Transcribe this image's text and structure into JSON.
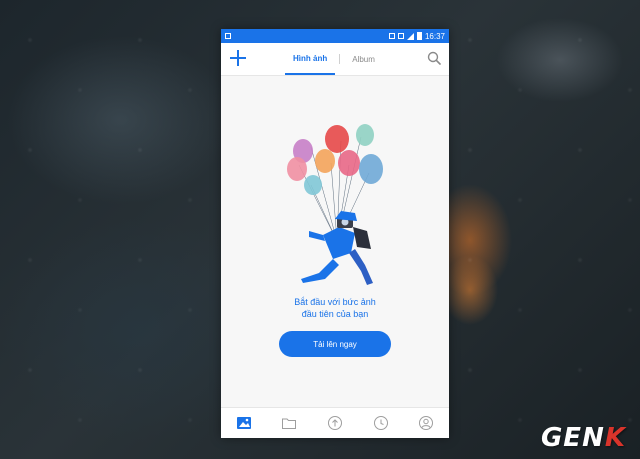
{
  "status_bar": {
    "time": "16:37"
  },
  "header": {
    "tabs": [
      {
        "label": "Hình ảnh",
        "active": true
      },
      {
        "label": "Album",
        "active": false
      }
    ]
  },
  "empty_state": {
    "line1": "Bắt đầu với bức ảnh",
    "line2": "đầu tiên của bạn",
    "cta_label": "Tải lên ngay"
  },
  "bottom_nav": {
    "items": [
      {
        "icon": "photos-icon",
        "active": true
      },
      {
        "icon": "folder-icon",
        "active": false
      },
      {
        "icon": "upload-icon",
        "active": false
      },
      {
        "icon": "clock-icon",
        "active": false
      },
      {
        "icon": "profile-icon",
        "active": false
      }
    ]
  },
  "watermark": {
    "brand_left": "GEN",
    "brand_right": "K"
  },
  "colors": {
    "accent": "#1a73e8",
    "background": "#f7f7f7",
    "inactive": "#9e9e9e"
  }
}
